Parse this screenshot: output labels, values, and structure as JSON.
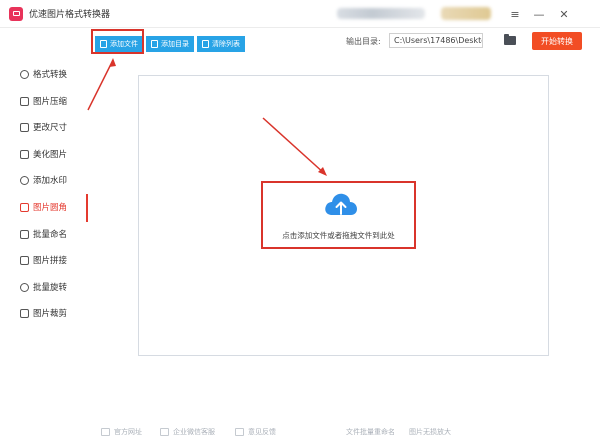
{
  "window": {
    "title": "优速图片格式转换器",
    "controls": [
      "menu-icon",
      "minimize-icon",
      "close-icon"
    ]
  },
  "toolbar": {
    "add_file": "添加文件",
    "add_folder": "添加目录",
    "clear_list": "清除列表",
    "output_label": "输出目录:",
    "output_path": "C:\\Users\\17486\\Deskto",
    "start_button": "开始转换"
  },
  "sidebar": {
    "items": [
      {
        "label": "格式转换",
        "icon": "format-convert-icon"
      },
      {
        "label": "图片压缩",
        "icon": "compress-icon"
      },
      {
        "label": "更改尺寸",
        "icon": "resize-icon"
      },
      {
        "label": "美化图片",
        "icon": "beautify-icon"
      },
      {
        "label": "添加水印",
        "icon": "watermark-icon"
      },
      {
        "label": "图片圆角",
        "icon": "round-corner-icon",
        "active": true
      },
      {
        "label": "批量命名",
        "icon": "rename-icon"
      },
      {
        "label": "图片拼接",
        "icon": "stitch-icon"
      },
      {
        "label": "批量旋转",
        "icon": "rotate-icon"
      },
      {
        "label": "图片裁剪",
        "icon": "crop-icon"
      }
    ]
  },
  "dropzone": {
    "hint": "点击添加文件或者拖拽文件到此处",
    "icon": "cloud-upload-icon"
  },
  "footer": {
    "items": [
      {
        "label": "官方网址",
        "icon": "website-icon"
      },
      {
        "label": "企业微信客服",
        "icon": "service-icon"
      },
      {
        "label": "意见反馈",
        "icon": "feedback-icon"
      }
    ],
    "links": [
      "文件批量重命名",
      "图片无损放大"
    ]
  },
  "colors": {
    "accent_blue": "#28a3e6",
    "start_orange": "#f24d24",
    "highlight_red": "#d9342b",
    "active_red": "#e43a2f",
    "cloud_blue": "#2f8fe8"
  }
}
